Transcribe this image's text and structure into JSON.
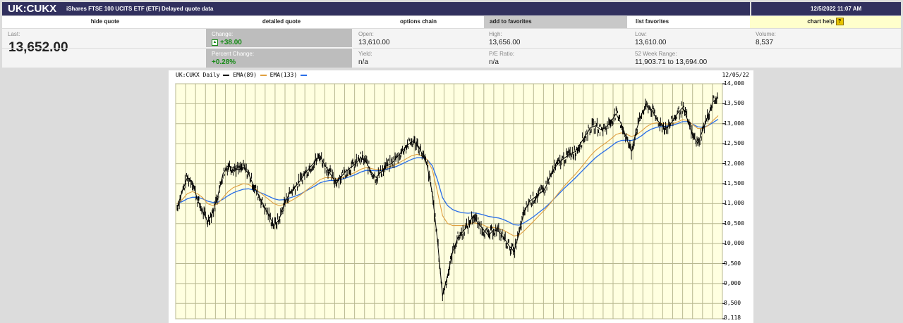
{
  "header": {
    "symbol": "UK:CUKX",
    "name": "iShares FTSE 100 UCITS ETF (ETF)",
    "delay_note": "Delayed quote data",
    "datetime": "12/5/2022 11:07 AM"
  },
  "nav": {
    "hide_quote": "hide quote",
    "detailed_quote": "detailed quote",
    "options_chain": "options chain",
    "add_favorites": "add to favorites",
    "list_favorites": "list favorites",
    "chart_help": "chart help",
    "help_mark": "?"
  },
  "quote": {
    "last_label": "Last:",
    "last_value": "13,652.00",
    "change_label": "Change:",
    "change_value": "+38.00",
    "pct_label": "Percent Change:",
    "pct_value": "+0.28%",
    "open_label": "Open:",
    "open_value": "13,610.00",
    "yield_label": "Yield:",
    "yield_value": "n/a",
    "high_label": "High:",
    "high_value": "13,656.00",
    "pe_label": "P/E Ratio:",
    "pe_value": "n/a",
    "low_label": "Low:",
    "low_value": "13,610.00",
    "range_label": "52 Week Range:",
    "range_value": "11,903.71 to 13,694.00",
    "volume_label": "Volume:",
    "volume_value": "8,537"
  },
  "chart": {
    "title": "UK:CUKX Daily",
    "ema1": "EMA(89)",
    "ema2": "EMA(133)",
    "date": "12/05/22",
    "colors": {
      "price": "#000000",
      "ema1": "#e0a040",
      "ema2": "#2a6ee8",
      "bg": "#ffffe0",
      "grid": "#b8b890"
    }
  },
  "chart_data": {
    "type": "line",
    "title": "UK:CUKX Daily",
    "date_label": "12/05/22",
    "y_ticks": [
      "14,000",
      "13,500",
      "13,000",
      "12,500",
      "12,000",
      "11,500",
      "11,000",
      "10,500",
      "10,000",
      "9,500",
      "9,000",
      "8,500",
      "8,118"
    ],
    "ylim": [
      8118,
      14000
    ],
    "series": [
      {
        "name": "UK:CUKX Daily",
        "values": [
          10900,
          11300,
          11650,
          11550,
          11100,
          10800,
          10550,
          10800,
          11200,
          11750,
          11950,
          11900,
          11850,
          11900,
          11750,
          11450,
          11200,
          10950,
          10700,
          10450,
          10600,
          11000,
          11250,
          11400,
          11550,
          11750,
          11900,
          12050,
          12200,
          11950,
          11750,
          11550,
          11650,
          11800,
          11900,
          12000,
          12150,
          12050,
          11800,
          11650,
          11800,
          11950,
          12000,
          12150,
          12300,
          12450,
          12550,
          12500,
          12250,
          11950,
          11250,
          10100,
          8700,
          9200,
          9800,
          10150,
          10300,
          10450,
          10700,
          10500,
          10350,
          10200,
          10350,
          10300,
          10150,
          9950,
          9800,
          10250,
          10800,
          11050,
          11150,
          11250,
          11350,
          11650,
          11900,
          12050,
          12150,
          12250,
          12300,
          12500,
          12700,
          12900,
          12950,
          12850,
          12900,
          13050,
          13250,
          13000,
          12650,
          12300,
          12850,
          13250,
          13450,
          13350,
          13100,
          12950,
          12900,
          13050,
          13250,
          13400,
          13100,
          12700,
          12500,
          12850,
          13200,
          13550,
          13652
        ]
      },
      {
        "name": "EMA(89)",
        "values": [
          11000,
          11100,
          11250,
          11300,
          11250,
          11150,
          11000,
          10950,
          11000,
          11150,
          11300,
          11400,
          11450,
          11500,
          11480,
          11400,
          11300,
          11200,
          11100,
          11000,
          10950,
          10980,
          11050,
          11120,
          11200,
          11300,
          11400,
          11500,
          11600,
          11650,
          11650,
          11620,
          11630,
          11680,
          11730,
          11790,
          11860,
          11900,
          11880,
          11850,
          11860,
          11900,
          11940,
          11990,
          12060,
          12130,
          12200,
          12230,
          12200,
          12100,
          11850,
          11300,
          10700,
          10500,
          10450,
          10450,
          10450,
          10480,
          10520,
          10500,
          10460,
          10410,
          10400,
          10380,
          10330,
          10260,
          10190,
          10210,
          10320,
          10450,
          10580,
          10710,
          10840,
          10990,
          11150,
          11310,
          11460,
          11600,
          11730,
          11880,
          12040,
          12200,
          12330,
          12430,
          12520,
          12620,
          12730,
          12770,
          12740,
          12680,
          12720,
          12820,
          12930,
          13000,
          13020,
          13010,
          12990,
          13000,
          13040,
          13100,
          13080,
          12980,
          12880,
          12880,
          12950,
          13080,
          13200
        ]
      },
      {
        "name": "EMA(133)",
        "values": [
          11000,
          11050,
          11120,
          11160,
          11160,
          11120,
          11060,
          11030,
          11040,
          11110,
          11200,
          11270,
          11320,
          11360,
          11370,
          11340,
          11290,
          11240,
          11180,
          11120,
          11090,
          11100,
          11140,
          11180,
          11230,
          11300,
          11370,
          11440,
          11520,
          11560,
          11580,
          11580,
          11600,
          11640,
          11680,
          11730,
          11790,
          11830,
          11830,
          11820,
          11830,
          11860,
          11890,
          11930,
          11990,
          12050,
          12110,
          12150,
          12150,
          12100,
          11950,
          11600,
          11150,
          10950,
          10850,
          10800,
          10770,
          10760,
          10770,
          10750,
          10720,
          10680,
          10660,
          10640,
          10600,
          10540,
          10470,
          10460,
          10520,
          10600,
          10690,
          10790,
          10890,
          11010,
          11140,
          11270,
          11400,
          11520,
          11640,
          11770,
          11900,
          12030,
          12150,
          12250,
          12340,
          12430,
          12530,
          12580,
          12590,
          12580,
          12620,
          12700,
          12800,
          12870,
          12910,
          12930,
          12940,
          12960,
          13000,
          13050,
          13050,
          12990,
          12920,
          12910,
          12950,
          13030,
          13110
        ]
      }
    ]
  }
}
